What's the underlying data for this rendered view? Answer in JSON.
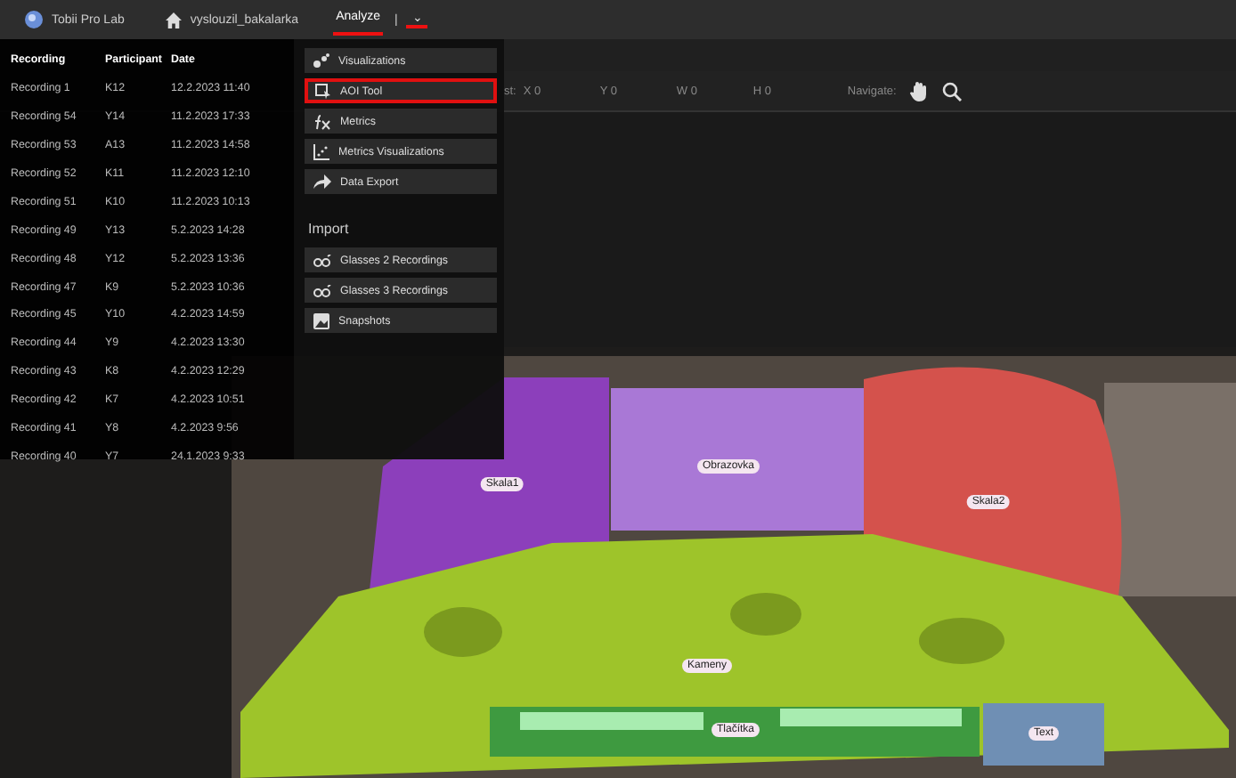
{
  "app_bar": {
    "app_name": "Tobii Pro Lab",
    "project": "vyslouzil_bakalarka",
    "tabs": [
      {
        "label": "Analyze",
        "selected": true
      }
    ],
    "separator": "|",
    "menu_caret": "⌄"
  },
  "toolbar": {
    "cut_label": "st:",
    "fields": [
      "X 0",
      "Y 0",
      "W 0",
      "H 0"
    ],
    "navigate": "Navigate:"
  },
  "recordings": {
    "columns": [
      "Recording",
      "Participant",
      "Date"
    ],
    "rows": [
      [
        "Recording 1",
        "K12",
        "12.2.2023 11:40"
      ],
      [
        "Recording 54",
        "Y14",
        "11.2.2023 17:33"
      ],
      [
        "Recording 53",
        "A13",
        "11.2.2023 14:58"
      ],
      [
        "Recording 52",
        "K11",
        "11.2.2023 12:10"
      ],
      [
        "Recording 51",
        "K10",
        "11.2.2023 10:13"
      ],
      [
        "Recording 49",
        "Y13",
        "5.2.2023 14:28"
      ],
      [
        "Recording 48",
        "Y12",
        "5.2.2023 13:36"
      ],
      [
        "Recording 47",
        "K9",
        "5.2.2023 10:36"
      ],
      [
        "Recording 45",
        "Y10",
        "4.2.2023 14:59"
      ],
      [
        "Recording 44",
        "Y9",
        "4.2.2023 13:30"
      ],
      [
        "Recording 43",
        "K8",
        "4.2.2023 12:29"
      ],
      [
        "Recording 42",
        "K7",
        "4.2.2023 10:51"
      ],
      [
        "Recording 41",
        "Y8",
        "4.2.2023 9:56"
      ],
      [
        "Recording 40",
        "Y7",
        "24.1.2023 9:33"
      ]
    ]
  },
  "analyze_menu": {
    "items": [
      {
        "label": "Visualizations",
        "kind": "visualizations",
        "selected": false
      },
      {
        "label": "AOI Tool",
        "kind": "aoi",
        "selected": true
      },
      {
        "label": "Metrics",
        "kind": "metrics",
        "selected": false
      },
      {
        "label": "Metrics Visualizations",
        "kind": "chart",
        "selected": false
      },
      {
        "label": "Data Export",
        "kind": "export",
        "selected": false
      }
    ],
    "section": "Import",
    "import_items": [
      {
        "label": "Glasses 2 Recordings",
        "kind": "glasses"
      },
      {
        "label": "Glasses 3 Recordings",
        "kind": "glasses"
      },
      {
        "label": "Snapshots",
        "kind": "snapshot"
      }
    ]
  },
  "aoi_labels": [
    "Skala1",
    "Obrazovka",
    "Skala2",
    "Kameny",
    "Tlačítka",
    "Text"
  ]
}
